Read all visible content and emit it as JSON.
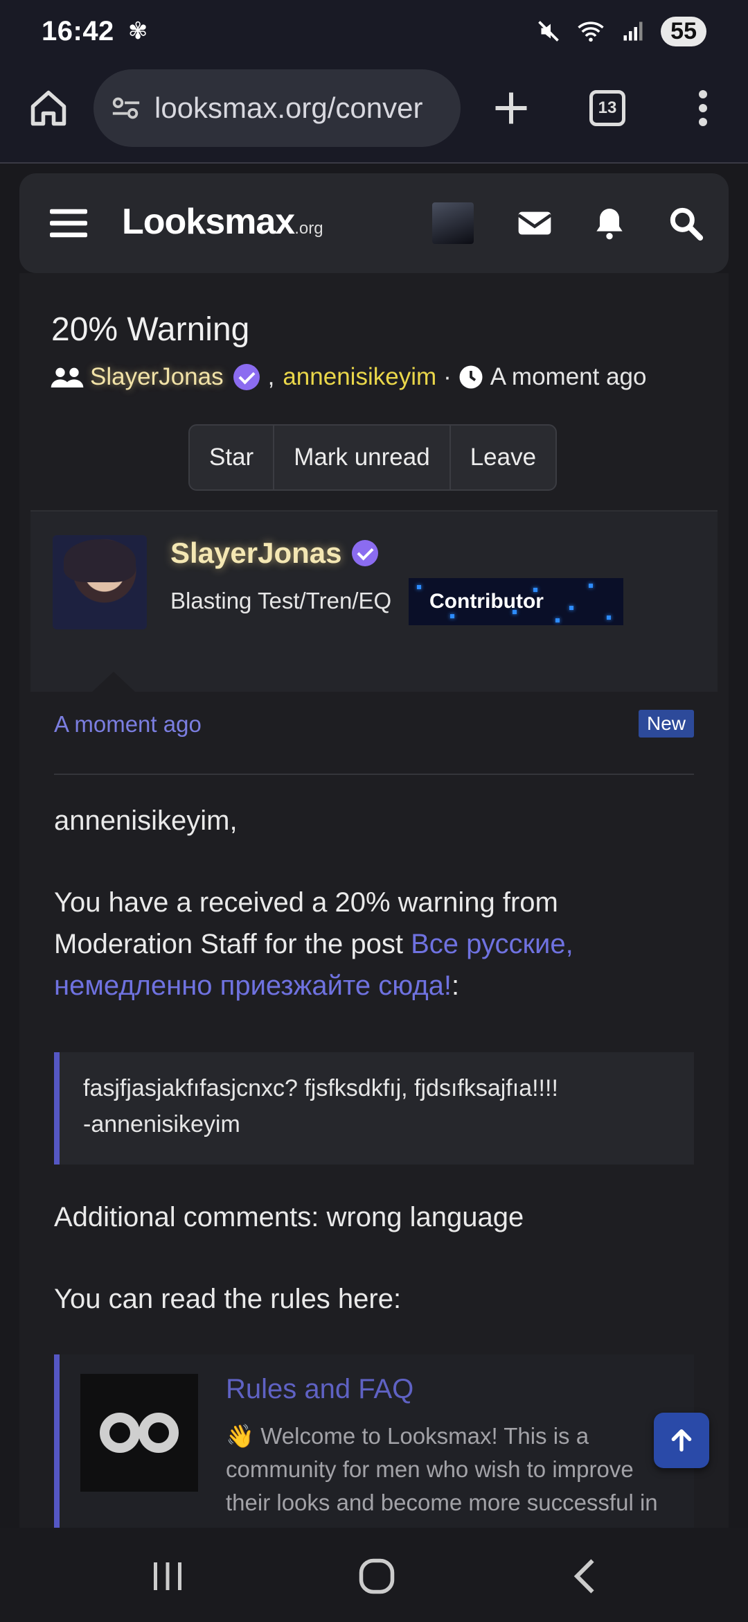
{
  "status_bar": {
    "time": "16:42",
    "battery": "55"
  },
  "browser": {
    "url": "looksmax.org/conver",
    "tab_count": "13"
  },
  "site": {
    "logo_main": "Looksmax",
    "logo_suffix": ".org"
  },
  "conversation": {
    "title": "20% Warning",
    "participant_1": "SlayerJonas",
    "separator": ",",
    "participant_2": "annenisikeyim",
    "dot": "·",
    "time": "A moment ago",
    "buttons": {
      "star": "Star",
      "mark_unread": "Mark unread",
      "leave": "Leave"
    }
  },
  "message": {
    "author": "SlayerJonas",
    "author_title": "Blasting Test/Tren/EQ",
    "badge": "Contributor",
    "time": "A moment ago",
    "new_label": "New",
    "greeting": "annenisikeyim,",
    "line1": "You have a received a 20% warning from Moderation Staff for the post ",
    "post_link": "Все русские, немедленно приезжайте сюда!",
    "colon": ":",
    "quote_line1": "fasjfjasjakfıfasjcnxc? fjsfksdkfıj, fjdsıfksajfıa!!!!",
    "quote_line2": "-annenisikeyim",
    "comment": "Additional comments: wrong language",
    "rules_intro": "You can read the rules here:",
    "embed_title": "Rules and FAQ",
    "embed_desc": "👋 Welcome to Looksmax! This is a community for men who wish to improve their looks and become more successful in"
  },
  "colors": {
    "accent": "#7b7ee0",
    "gold_user": "#f4e7b3",
    "link": "#6f72e0",
    "check": "#8b6cf0"
  }
}
